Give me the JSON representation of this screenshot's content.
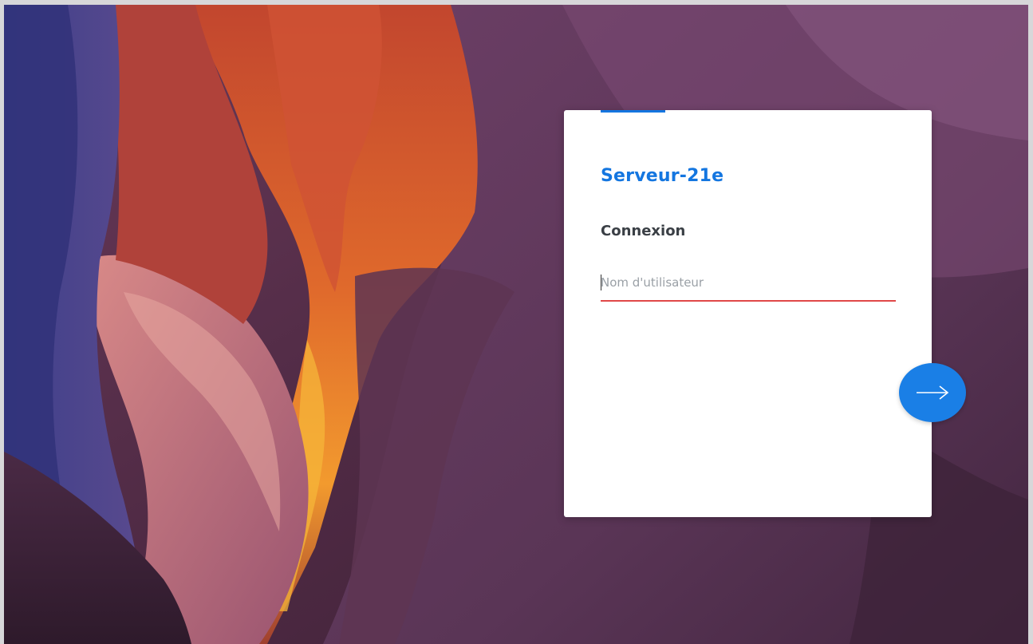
{
  "login": {
    "server_name": "Serveur-21e",
    "heading": "Connexion",
    "username": {
      "value": "",
      "placeholder": "Nom d'utilisateur"
    },
    "next_button_icon": "arrow-right-icon"
  },
  "colors": {
    "accent": "#1476e0",
    "button": "#1a7fe6",
    "field_underline": "#e04848",
    "heading": "#3a3f45"
  },
  "background": "canyon-wallpaper"
}
